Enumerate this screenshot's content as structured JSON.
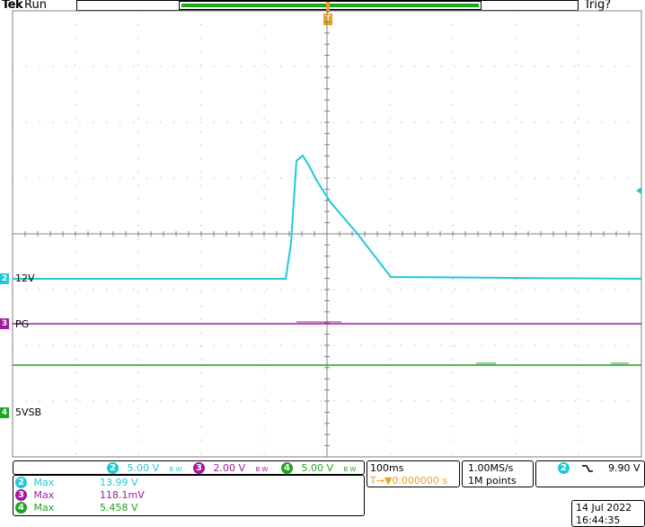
{
  "header": {
    "brand": "Tek",
    "run_state": "Run",
    "trig_state": "Trig?"
  },
  "channels": [
    {
      "num": "2",
      "label": "12V",
      "color": "#22c8d8",
      "scale": "5.00 V"
    },
    {
      "num": "3",
      "label": "PG",
      "color": "#a01aa0",
      "scale": "2.00 V"
    },
    {
      "num": "4",
      "label": "5VSB",
      "color": "#1ea51e",
      "scale": "5.00 V"
    }
  ],
  "bw_marker": "B W",
  "timebase": {
    "scale": "100ms",
    "position": "0.000000 s",
    "position_prefix": "T→▼"
  },
  "acquisition": {
    "rate": "1.00MS/s",
    "length": "1M points"
  },
  "trigger": {
    "channel": "2",
    "slope_icon": "falling-edge",
    "level": "9.90 V"
  },
  "measurements": [
    {
      "num": "2",
      "name": "Max",
      "value": "13.99 V",
      "color": "#22c8d8"
    },
    {
      "num": "3",
      "name": "Max",
      "value": "118.1mV",
      "color": "#a01aa0"
    },
    {
      "num": "4",
      "name": "Max",
      "value": "5.458 V",
      "color": "#1ea51e"
    }
  ],
  "datetime": {
    "date": "14 Jul  2022",
    "time": "16:44:35"
  },
  "trigger_marker": "T",
  "ch_colors": {
    "ch2": "#22c8d8",
    "ch3": "#a01aa0",
    "ch4": "#1ea51e",
    "trigger": "#f0a020"
  }
}
